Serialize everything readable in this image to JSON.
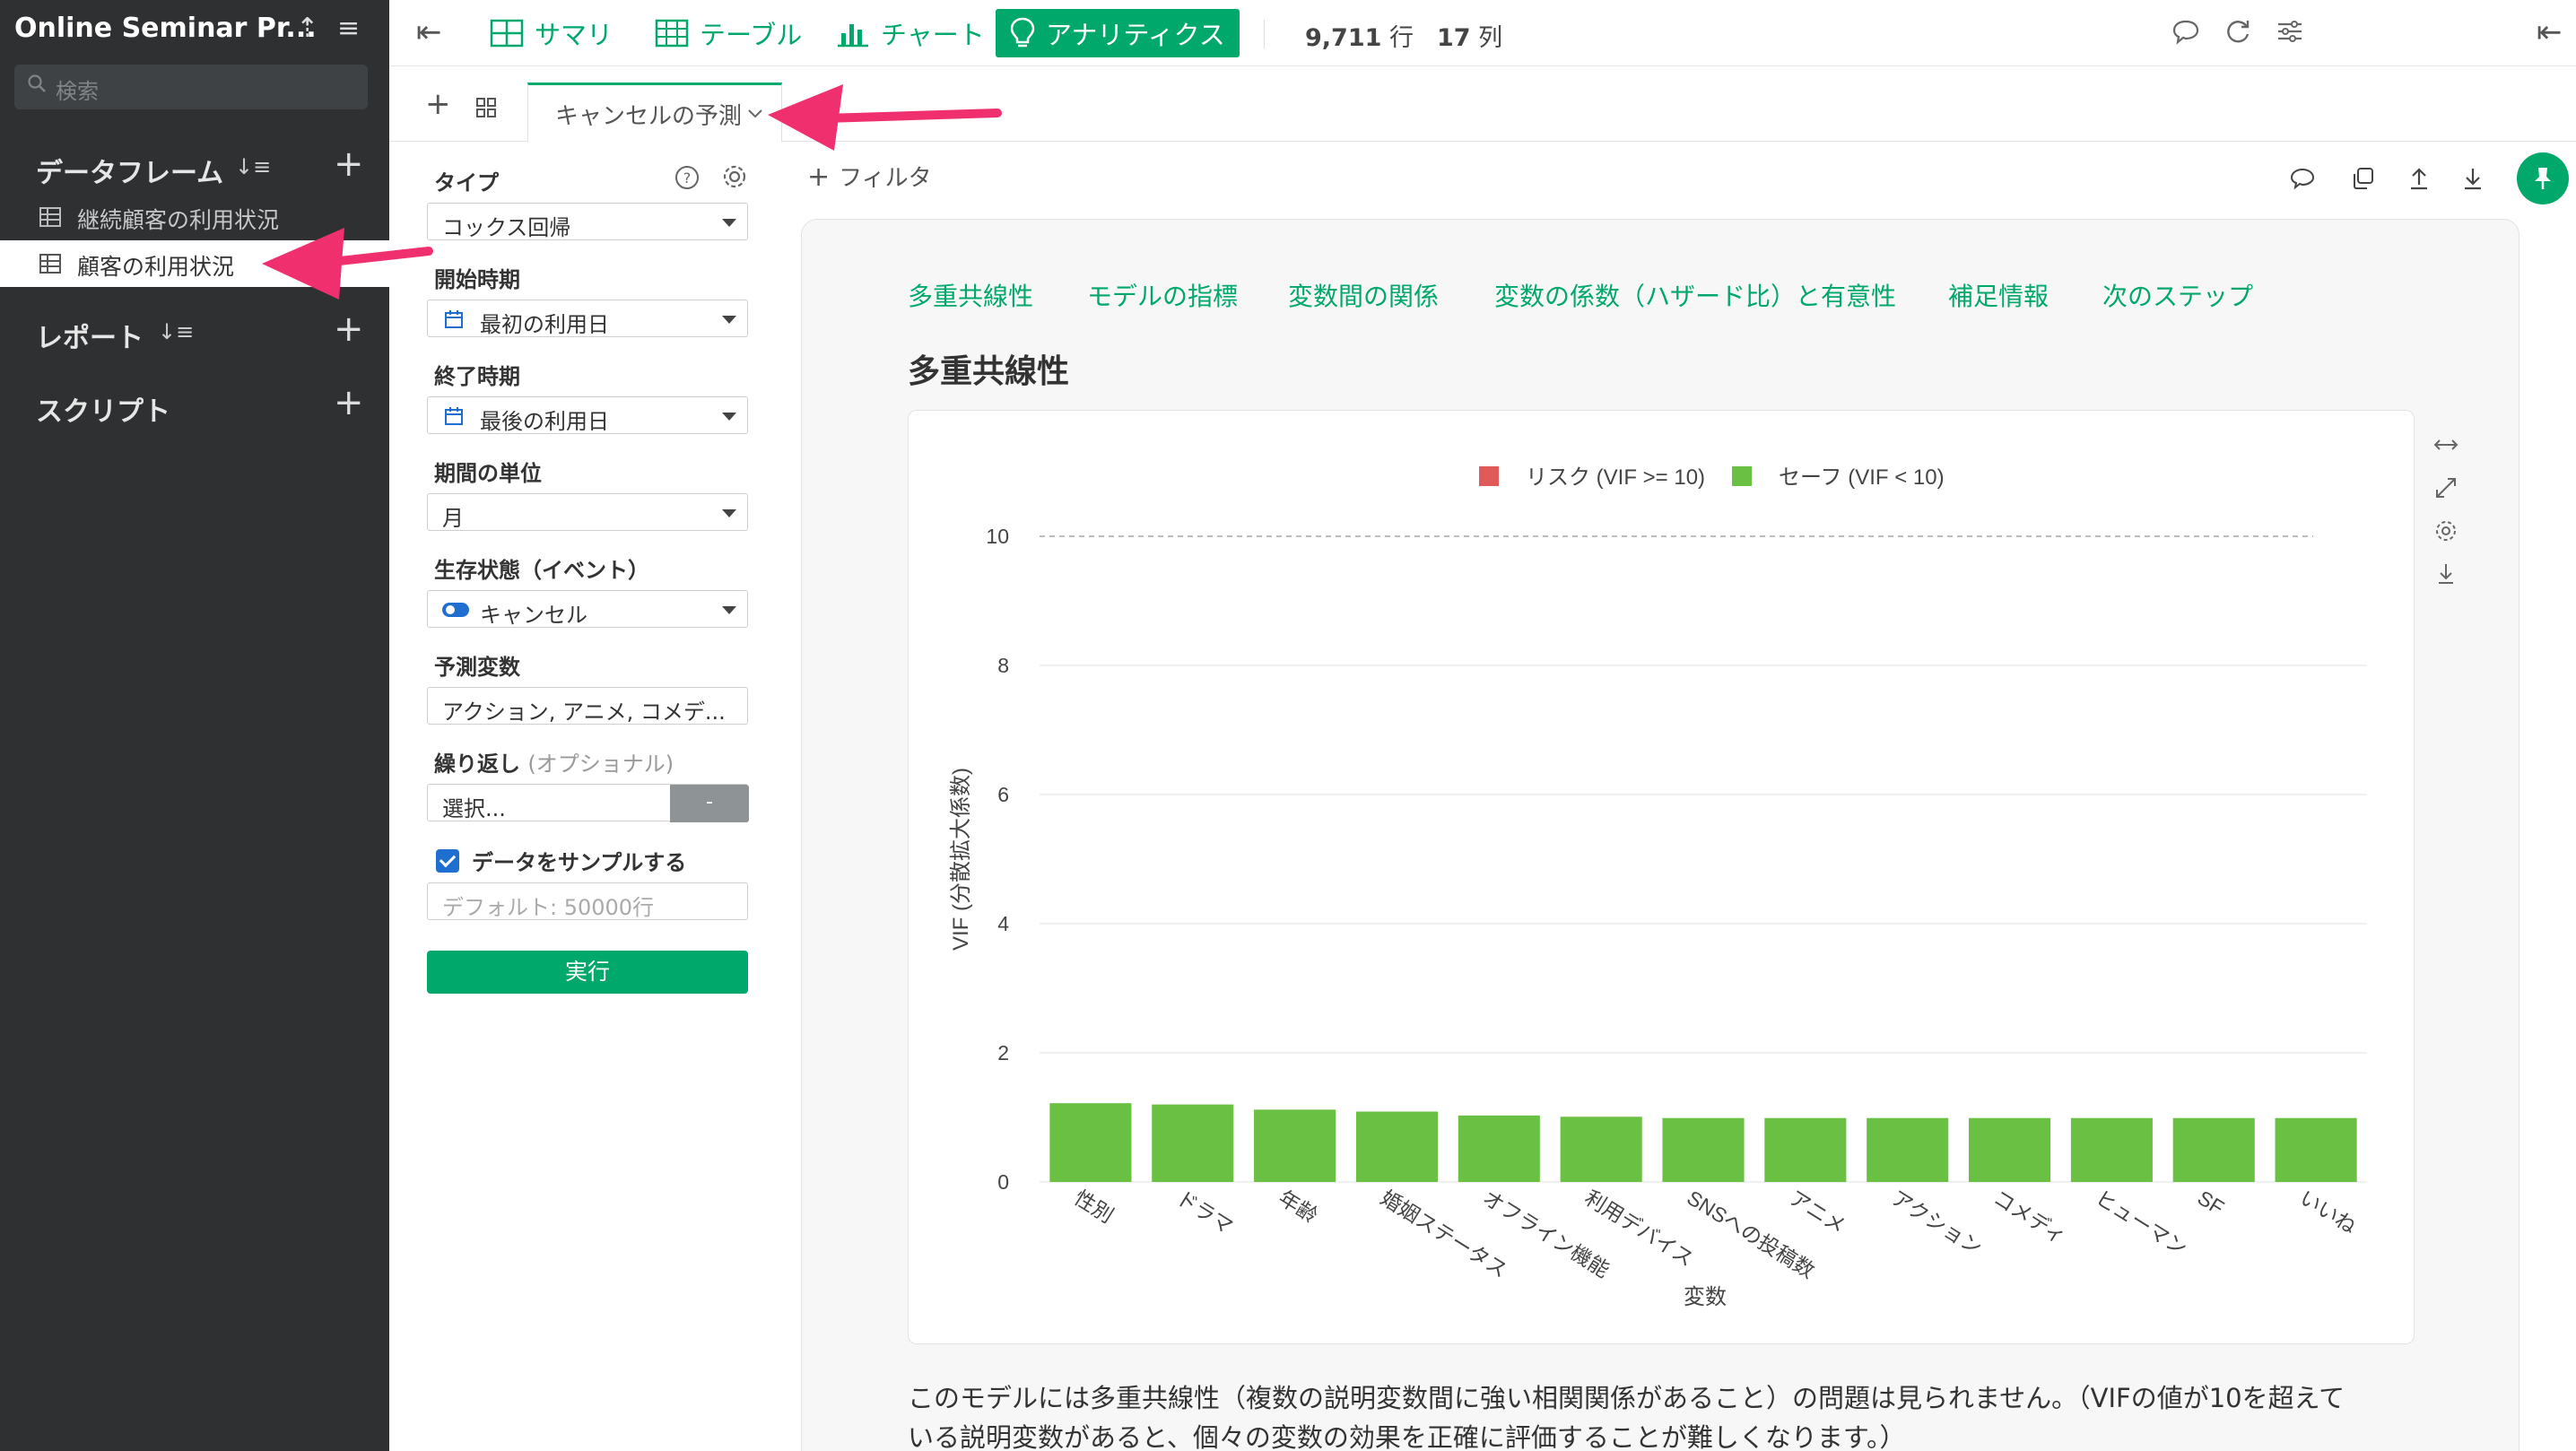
{
  "sidebar": {
    "project_title": "Online Seminar Pr...",
    "search_placeholder": "検索",
    "sections": {
      "dataframes": "データフレーム",
      "reports": "レポート",
      "scripts": "スクリプト"
    },
    "dataframes": [
      {
        "label": "継続顧客の利用状況"
      },
      {
        "label": "顧客の利用状況"
      }
    ]
  },
  "topbar": {
    "tabs": [
      {
        "label": "サマリ"
      },
      {
        "label": "テーブル"
      },
      {
        "label": "チャート"
      },
      {
        "label": "アナリティクス"
      }
    ],
    "rows_value": "9,711",
    "rows_unit": "行",
    "cols_value": "17",
    "cols_unit": "列"
  },
  "subtabs": {
    "active_tab": "キャンセルの予測"
  },
  "panel": {
    "type_label": "タイプ",
    "type_value": "コックス回帰",
    "start_label": "開始時期",
    "start_value": "最初の利用日",
    "end_label": "終了時期",
    "end_value": "最後の利用日",
    "unit_label": "期間の単位",
    "unit_value": "月",
    "status_label": "生存状態（イベント）",
    "status_value": "キャンセル",
    "predictors_label": "予測変数",
    "predictors_value": "アクション, アニメ, コメデ...",
    "repeat_label": "繰り返し",
    "repeat_optional": "(オプショナル)",
    "repeat_placeholder": "選択...",
    "repeat_btn": "-",
    "sample_label": "データをサンプルする",
    "sample_placeholder": "デフォルト: 50000行",
    "run_label": "実行"
  },
  "content": {
    "filter_label": "フィルタ",
    "nav": [
      "多重共線性",
      "モデルの指標",
      "変数間の関係",
      "変数の係数（ハザード比）と有意性",
      "補足情報",
      "次のステップ"
    ],
    "section_title": "多重共線性",
    "body_line1": "このモデルには多重共線性（複数の説明変数間に強い相関関係があること）の問題は見られません。（VIFの値が10を超えて",
    "body_line2": "いる説明変数があると、個々の変数の効果を正確に評価することが難しくなります。）"
  },
  "chart_data": {
    "type": "bar",
    "categories": [
      "性別",
      "ドラマ",
      "年齢",
      "婚姻ステータス",
      "オフライン機能",
      "利用デバイス",
      "SNSへの投稿数",
      "アニメ",
      "アクション",
      "コメディ",
      "ヒューマン",
      "SF",
      "いいね"
    ],
    "values": [
      1.22,
      1.2,
      1.12,
      1.09,
      1.03,
      1.01,
      0.99,
      0.99,
      0.99,
      0.99,
      0.99,
      0.99,
      0.99
    ],
    "xlabel": "変数",
    "ylabel": "VIF (分散拡大係数)",
    "ylim": [
      0,
      10
    ],
    "yticks": [
      "0",
      "2",
      "4",
      "6",
      "8",
      "10"
    ],
    "threshold": 10,
    "legend": [
      {
        "label": "リスク (VIF >= 10)",
        "color": "#e05a5a"
      },
      {
        "label": "セーフ (VIF < 10)",
        "color": "#6ac042"
      }
    ],
    "bar_color": "#6ac042",
    "legend_position": "top-center",
    "grid": true
  },
  "colors": {
    "accent": "#00a86b",
    "sidebar_bg": "#2e3032",
    "annotation_arrow": "#f0306e"
  }
}
